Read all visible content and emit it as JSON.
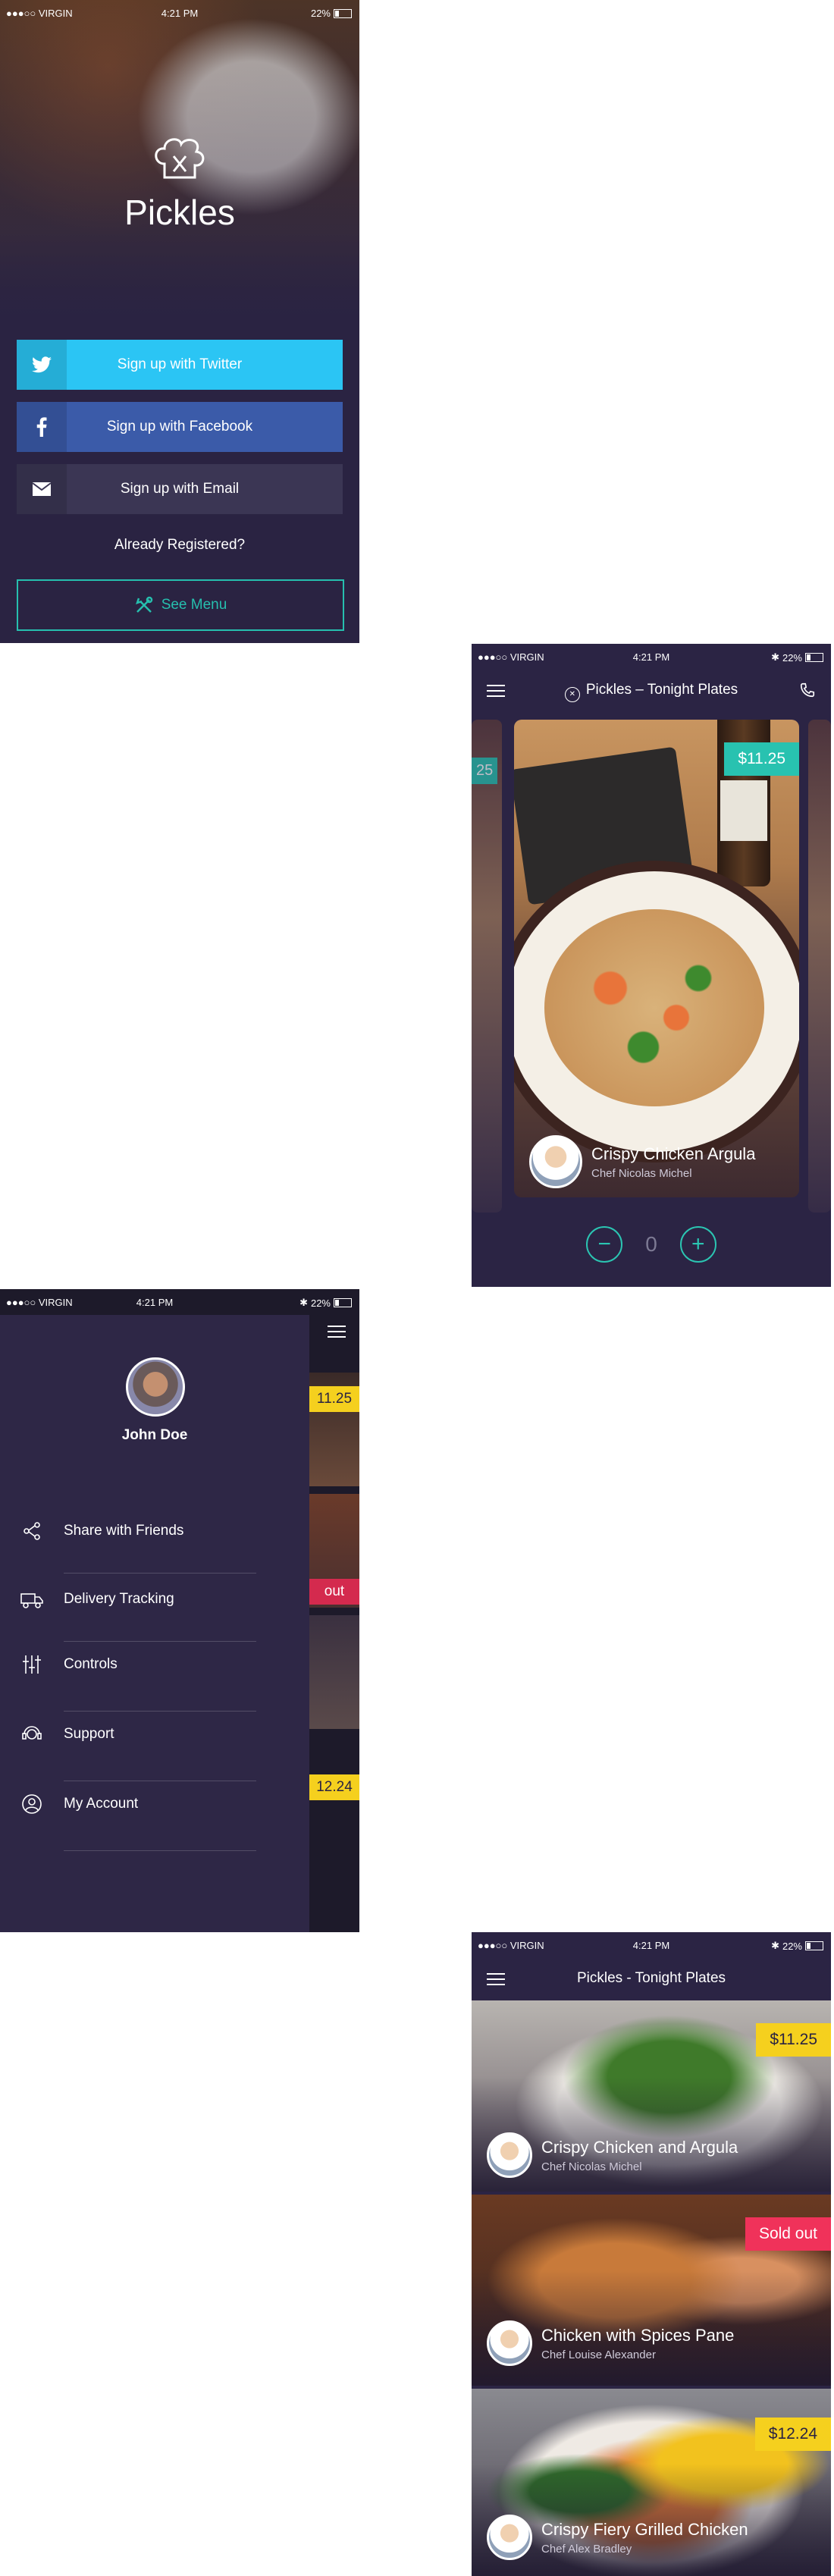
{
  "status": {
    "carrier": "●●●○○ VIRGIN",
    "time": "4:21 PM",
    "battery": "22%"
  },
  "signup": {
    "brand": "Pickles",
    "twitter": "Sign up with Twitter",
    "facebook": "Sign up with Facebook",
    "email": "Sign up with Email",
    "already": "Already Registered?",
    "see_menu": "See Menu",
    "colors": {
      "twitter": "#2bc5f4",
      "facebook": "#3b5ba9",
      "accent": "#26bfae"
    }
  },
  "detail": {
    "title": "Pickles – Tonight Plates",
    "side_price": "25",
    "price": "$11.25",
    "dish": "Crispy Chicken Argula",
    "chef": "Chef Nicolas Michel",
    "qty": "0",
    "minus": "−",
    "plus": "+"
  },
  "drawer": {
    "user": "John Doe",
    "items": [
      {
        "label": "Share with Friends",
        "icon": "share-icon"
      },
      {
        "label": "Delivery Tracking",
        "icon": "delivery-truck-icon"
      },
      {
        "label": "Controls",
        "icon": "sliders-icon"
      },
      {
        "label": "Support",
        "icon": "support-icon"
      },
      {
        "label": "My Account",
        "icon": "user-icon"
      }
    ],
    "peek": [
      "11.25",
      "out",
      "12.24"
    ]
  },
  "list": {
    "title": "Pickles - Tonight Plates",
    "items": [
      {
        "dish": "Crispy Chicken and Argula",
        "chef": "Chef Nicolas Michel",
        "badge": "$11.25",
        "badge_color": "#f5d01e"
      },
      {
        "dish": "Chicken with Spices Pane",
        "chef": "Chef Louise Alexander",
        "badge": "Sold out",
        "badge_color": "#f0325a"
      },
      {
        "dish": "Crispy Fiery Grilled Chicken",
        "chef": "Chef Alex Bradley",
        "badge": "$12.24",
        "badge_color": "#f5d01e"
      }
    ]
  }
}
